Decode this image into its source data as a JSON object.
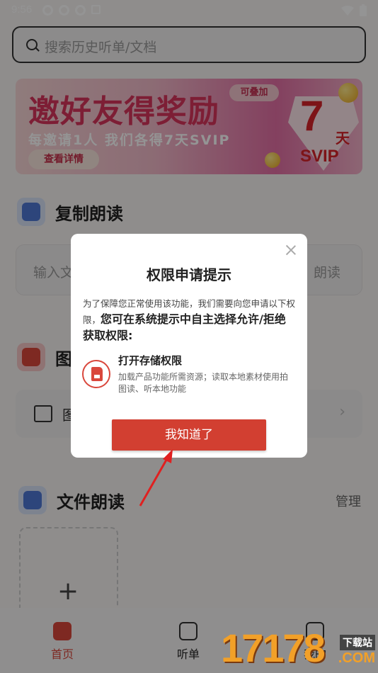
{
  "status_bar": {
    "time": "9:56"
  },
  "search": {
    "placeholder": "搜索历史听单/文档"
  },
  "banner": {
    "title": "邀好友得奖励",
    "subtitle": "每邀请1人 我们各得7天SVIP",
    "detail_button": "查看详情",
    "stack_badge": "可叠加",
    "reward_number": "7",
    "reward_unit": "天",
    "reward_tier": "SVIP"
  },
  "copy_read": {
    "title": "复制朗读",
    "input_placeholder": "输入文",
    "action": "朗读"
  },
  "image_read": {
    "title_partial": "图",
    "row_label_partial": "图"
  },
  "file_read": {
    "title": "文件朗读",
    "manage": "管理",
    "add_symbol": "+"
  },
  "bottom_nav": {
    "items": [
      {
        "label": "首页"
      },
      {
        "label": "听单"
      },
      {
        "label": "我的"
      }
    ]
  },
  "dialog": {
    "title": "权限申请提示",
    "body_prefix": "为了保障您正常使用该功能，我们需要向您申请以下权限，",
    "body_bold": "您可在系统提示中自主选择允许/拒绝获取权限:",
    "permission": {
      "title": "打开存储权限",
      "description": "加载产品功能所需资源；读取本地素材使用拍图读、听本地功能"
    },
    "confirm_button": "我知道了"
  },
  "watermark": {
    "number": "17178",
    "tag": "下载站",
    "domain": ".COM"
  },
  "colors": {
    "accent": "#d23f31",
    "banner_text": "#d8345c"
  }
}
